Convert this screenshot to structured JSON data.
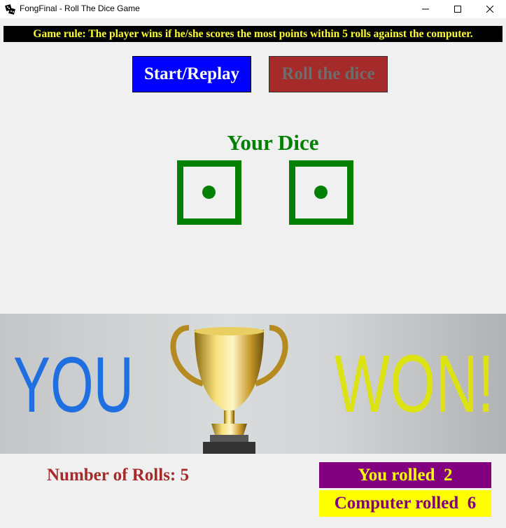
{
  "window": {
    "title": "FongFinal - Roll The Dice Game",
    "app_icon": "dice-icon",
    "controls": [
      "minimize-icon",
      "maximize-icon",
      "close-icon"
    ]
  },
  "rule": {
    "text": "Game rule: The player wins if he/she scores the most points within 5 rolls against the computer."
  },
  "buttons": {
    "start": "Start/Replay",
    "roll": "Roll the dice"
  },
  "dice": {
    "title": "Your Dice",
    "values": [
      1,
      1
    ]
  },
  "result_banner": {
    "word1": "YOU",
    "word2": "WON!",
    "image": "trophy-icon"
  },
  "stats": {
    "rolls_label": "Number of Rolls: 5",
    "you_rolled": "You rolled  2",
    "computer_rolled": "Computer rolled  6"
  },
  "colors": {
    "rule_bg": "#000000",
    "rule_text": "#ffff33",
    "start_bg": "#0000ff",
    "roll_bg": "#a52a2a",
    "dice": "#008000",
    "you_text": "#1f6fe0",
    "won_text": "#dde313",
    "rolls_text": "#a52a2a",
    "you_rolled_bg": "#800080",
    "computer_rolled_bg": "#ffff00"
  }
}
